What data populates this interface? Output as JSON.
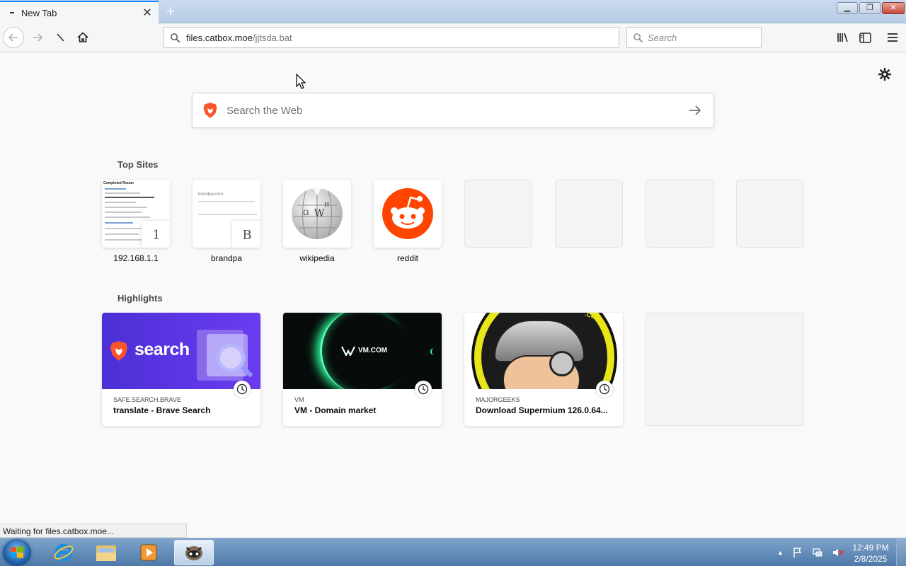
{
  "browser": {
    "tab_title": "New Tab",
    "url_host": "files.catbox.moe",
    "url_path": "/jjtsda.bat",
    "search_placeholder": "Search"
  },
  "newtab": {
    "web_search_placeholder": "Search the Web",
    "top_sites_title": "Top Sites",
    "highlights_title": "Highlights",
    "top_sites": [
      {
        "label": "192.168.1.1",
        "letter": "1",
        "shot_heading": "Completed Router"
      },
      {
        "label": "brandpa",
        "letter": "B",
        "shot_heading": "brandpa.com"
      },
      {
        "label": "wikipedia"
      },
      {
        "label": "reddit"
      }
    ],
    "highlights": [
      {
        "host": "SAFE.SEARCH.BRAVE",
        "title": "translate - Brave Search",
        "image_text": "search"
      },
      {
        "host": "VM",
        "title": "VM - Domain market",
        "image_text": "VM.COM"
      },
      {
        "host": "MAJORGEEKS",
        "title": "Download Supermium 126.0.64...",
        "image_text": ".COM"
      }
    ]
  },
  "status": {
    "text": "Waiting for files.catbox.moe..."
  },
  "taskbar": {
    "time": "12:49 PM",
    "date": "2/8/2025"
  },
  "colors": {
    "accent": "#0a84ff",
    "brave_orange": "#fb542b",
    "reddit_orange": "#ff4500",
    "brave_purple": "#4c2fd6"
  }
}
